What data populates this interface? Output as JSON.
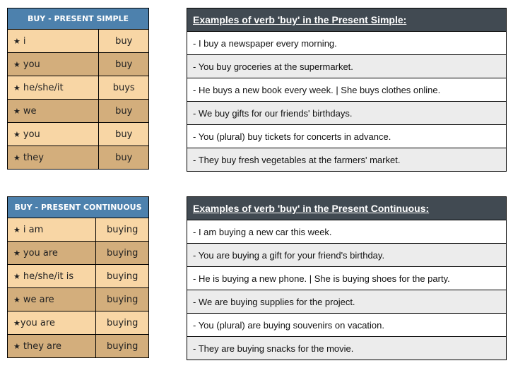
{
  "present_simple": {
    "conjugation": {
      "header": "BUY - PRESENT SIMPLE",
      "rows": [
        {
          "pronoun": "i",
          "verb": "buy"
        },
        {
          "pronoun": "you",
          "verb": "buy"
        },
        {
          "pronoun": "he/she/it",
          "verb": "buys"
        },
        {
          "pronoun": "we",
          "verb": "buy"
        },
        {
          "pronoun": "you",
          "verb": "buy"
        },
        {
          "pronoun": "they",
          "verb": "buy"
        }
      ]
    },
    "examples": {
      "header": "Examples of verb 'buy' in the Present Simple:",
      "items": [
        "- I buy a newspaper every morning.",
        "- You buy groceries at the supermarket.",
        "- He buys a new book every week. | She buys clothes online.",
        "- We buy gifts for our friends' birthdays.",
        "- You (plural) buy tickets for concerts in advance.",
        "- They buy fresh vegetables at the farmers' market."
      ]
    }
  },
  "present_continuous": {
    "conjugation": {
      "header": "BUY - PRESENT CONTINUOUS",
      "rows": [
        {
          "pronoun": "i am",
          "verb": "buying"
        },
        {
          "pronoun": "you are",
          "verb": "buying"
        },
        {
          "pronoun": "he/she/it is",
          "verb": "buying"
        },
        {
          "pronoun": "we are",
          "verb": "buying"
        },
        {
          "pronoun": "you are",
          "verb": "buying",
          "nospace": true
        },
        {
          "pronoun": "they are",
          "verb": "buying"
        }
      ]
    },
    "examples": {
      "header": "Examples of verb 'buy' in the Present Continuous:",
      "items": [
        "- I am buying a new car this week.",
        "- You are buying a gift for your friend's birthday.",
        "- He is buying a new phone. | She is buying shoes for the party.",
        "- We are buying supplies for the project.",
        "- You (plural) are buying souvenirs on vacation.",
        "- They are buying snacks for the movie."
      ]
    }
  },
  "icons": {
    "bullet": "★"
  },
  "colors": {
    "conj_header": "#4d81ad",
    "row_light": "#f8d6a5",
    "row_dark": "#d3ae7c",
    "examples_header": "#414a52",
    "examples_alt": "#ececec"
  }
}
